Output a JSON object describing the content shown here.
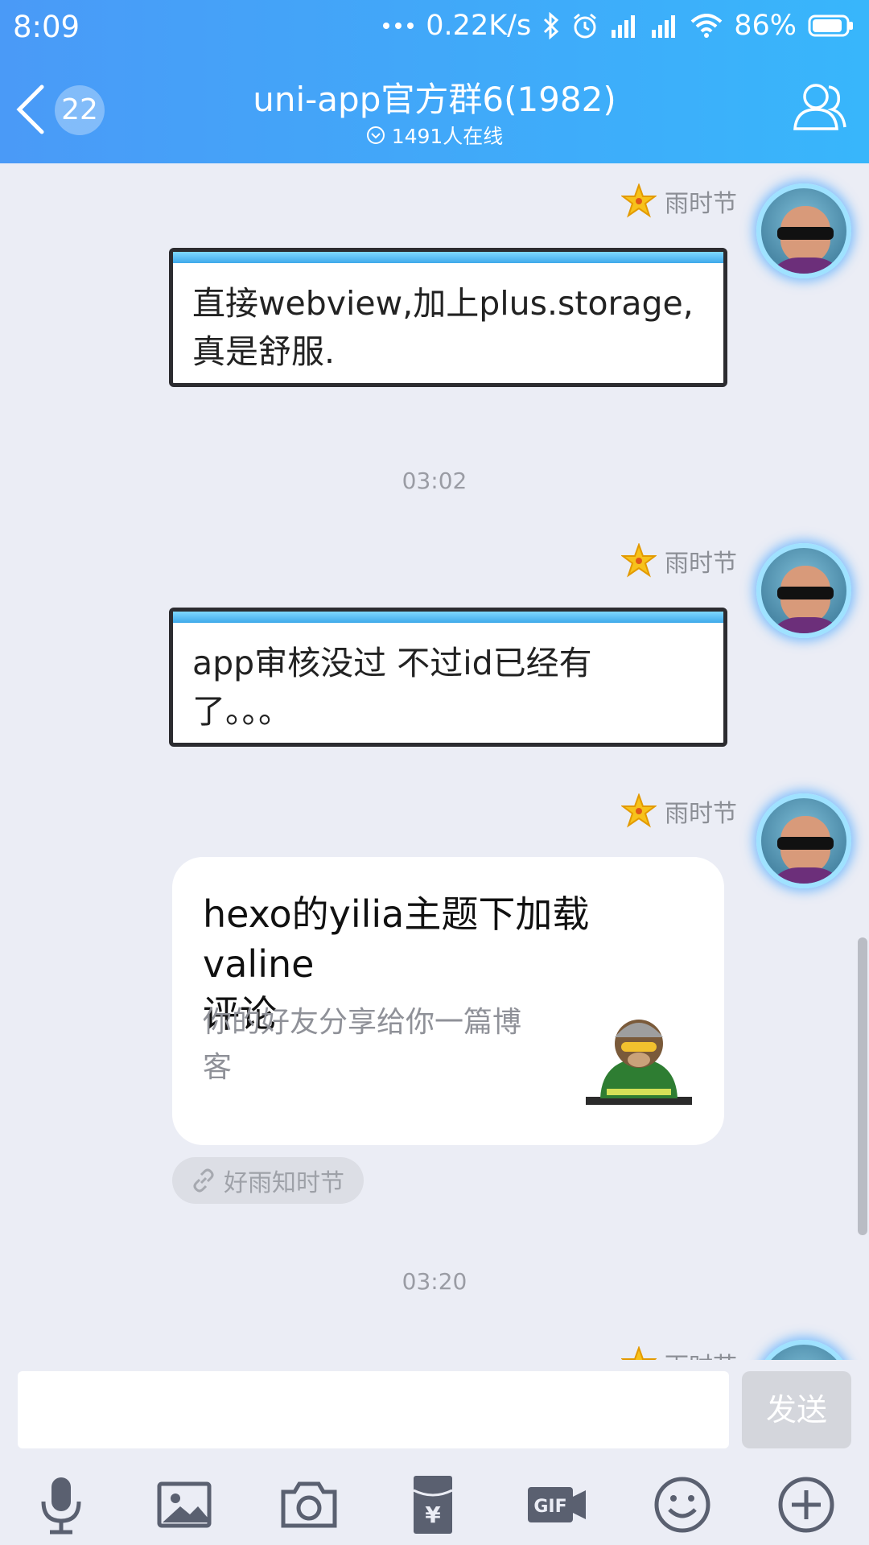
{
  "status_bar": {
    "time": "8:09",
    "network_speed": "0.22K/s",
    "battery": "86%",
    "icons": [
      "more-dots-icon",
      "bluetooth-icon",
      "alarm-icon",
      "signal-icon",
      "signal-icon",
      "wifi-icon",
      "battery-icon"
    ]
  },
  "header": {
    "back_badge": "22",
    "title": "uni-app官方群6(1982)",
    "subtitle": "1491人在线",
    "right_icon": "group-members-icon"
  },
  "messages": [
    {
      "sender": "雨时节",
      "text_lines": [
        "直接webview,加上plus.storage,",
        "真是舒服."
      ]
    },
    {
      "timestamp": "03:02"
    },
    {
      "sender": "雨时节",
      "text_lines": [
        "app审核没过 不过id已经有",
        "了。。。"
      ]
    },
    {
      "sender": "雨时节",
      "share": {
        "title_lines": [
          "hexo的yilia主题下加载valine",
          "评论"
        ],
        "desc_lines": [
          "你的好友分享给你一篇博",
          "客"
        ],
        "source": "好雨知时节"
      }
    },
    {
      "timestamp": "03:20"
    },
    {
      "sender": "雨时节"
    }
  ],
  "input": {
    "placeholder": "",
    "send_label": "发送"
  },
  "toolbar": [
    "microphone-icon",
    "image-icon",
    "camera-icon",
    "red-packet-icon",
    "gif-icon",
    "emoji-icon",
    "plus-icon"
  ],
  "colors": {
    "header_start": "#4a9af7",
    "header_end": "#38b6fb",
    "background": "#ebedf5"
  }
}
